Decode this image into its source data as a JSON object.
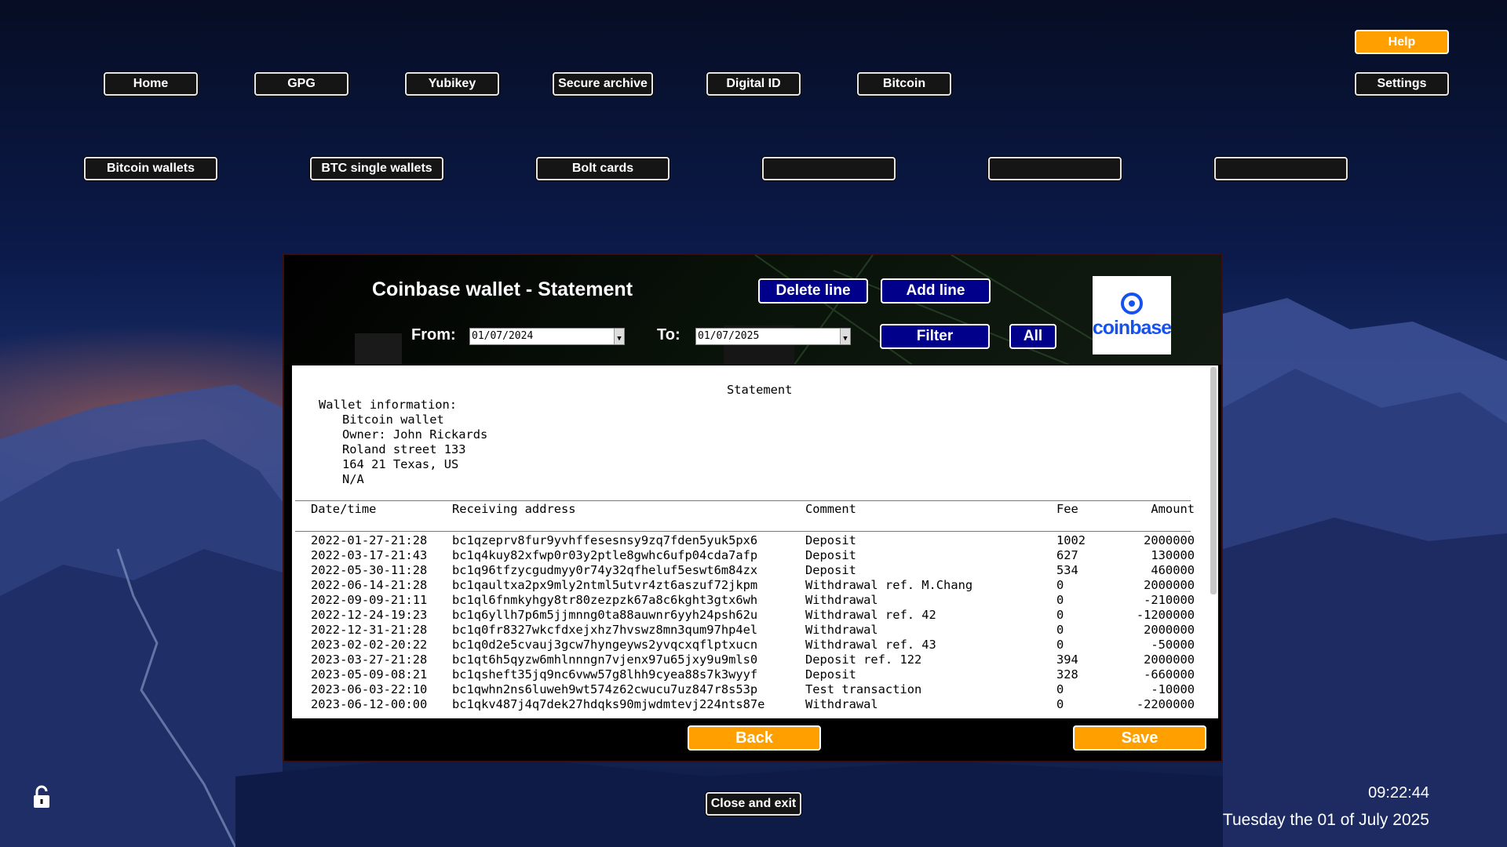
{
  "nav": {
    "top": [
      "Home",
      "GPG",
      "Yubikey",
      "Secure archive",
      "Digital ID",
      "Bitcoin"
    ],
    "help": "Help",
    "settings": "Settings",
    "second": [
      "Bitcoin wallets",
      "BTC single wallets",
      "Bolt cards",
      "",
      "",
      ""
    ]
  },
  "panel": {
    "title": "Coinbase wallet - Statement",
    "delete_line": "Delete line",
    "add_line": "Add line",
    "from_label": "From:",
    "from_value": "01/07/2024",
    "to_label": "To:",
    "to_value": "01/07/2025",
    "filter": "Filter",
    "all": "All",
    "logo_text": "coinbase",
    "back": "Back",
    "save": "Save"
  },
  "statement": {
    "heading": "Statement",
    "wallet_info_label": "Wallet information:",
    "wallet_lines": [
      "Bitcoin wallet",
      "Owner: John Rickards",
      "Roland street 133",
      "164 21 Texas, US",
      "N/A"
    ],
    "columns": [
      "Date/time",
      "Receiving address",
      "Comment",
      "Fee",
      "Amount"
    ],
    "rows": [
      [
        "2022-01-27-21:28",
        "bc1qzeprv8fur9yvhffesesnsy9zq7fden5yuk5px6",
        "Deposit",
        "1002",
        "2000000"
      ],
      [
        "2022-03-17-21:43",
        "bc1q4kuy82xfwp0r03y2ptle8gwhc6ufp04cda7afp",
        "Deposit",
        "627",
        "130000"
      ],
      [
        "2022-05-30-11:28",
        "bc1q96tfzycgudmyy0r74y32qfheluf5eswt6m84zx",
        "Deposit",
        "534",
        "460000"
      ],
      [
        "2022-06-14-21:28",
        "bc1qaultxa2px9mly2ntml5utvr4zt6aszuf72jkpm",
        "Withdrawal ref. M.Chang",
        "0",
        "2000000"
      ],
      [
        "2022-09-09-21:11",
        "bc1ql6fnmkyhgy8tr80zezpzk67a8c6kght3gtx6wh",
        "Withdrawal",
        "0",
        "-210000"
      ],
      [
        "2022-12-24-19:23",
        "bc1q6yllh7p6m5jjmnng0ta88auwnr6yyh24psh62u",
        "Withdrawal ref. 42",
        "0",
        "-1200000"
      ],
      [
        "2022-12-31-21:28",
        "bc1q0fr8327wkcfdxejxhz7hvswz8mn3qum97hp4el",
        "Withdrawal",
        "0",
        "2000000"
      ],
      [
        "2023-02-02-20:22",
        "bc1q0d2e5cvauj3gcw7hyngeyws2yvqcxqflptxucn",
        "Withdrawal ref. 43",
        "0",
        "-50000"
      ],
      [
        "2023-03-27-21:28",
        "bc1qt6h5qyzw6mhlnnngn7vjenx97u65jxy9u9mls0",
        "Deposit ref. 122",
        "394",
        "2000000"
      ],
      [
        "2023-05-09-08:21",
        "bc1qsheft35jq9nc6vww57g8lhh9cyea88s7k3wyyf",
        "Deposit",
        "328",
        "-660000"
      ],
      [
        "2023-06-03-22:10",
        "bc1qwhn2ns6luweh9wt574z62cwucu7uz847r8s53p",
        "Test transaction",
        "0",
        "-10000"
      ],
      [
        "2023-06-12-00:00",
        "bc1qkv487j4q7dek27hdqks90mjwdmtevj224nts87e",
        "Withdrawal",
        "0",
        "-2200000"
      ]
    ]
  },
  "footer": {
    "close_exit": "Close and exit",
    "time": "09:22:44",
    "date": "Tuesday the 01 of July 2025"
  }
}
